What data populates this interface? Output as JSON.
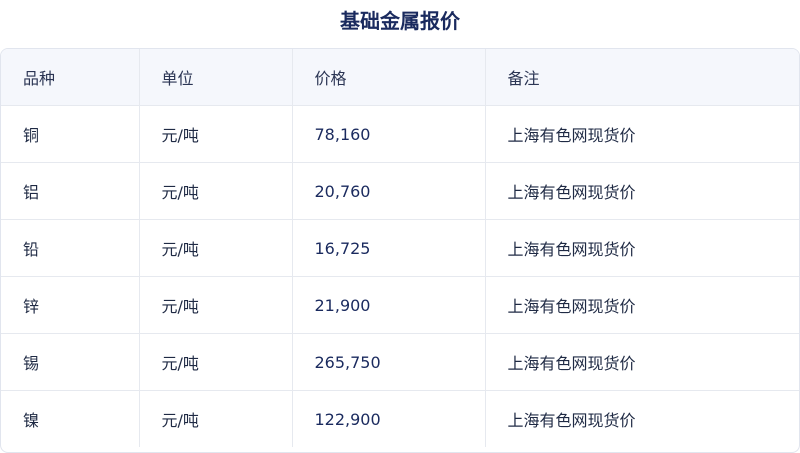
{
  "title": "基础金属报价",
  "table": {
    "headers": [
      "品种",
      "单位",
      "价格",
      "备注"
    ],
    "rows": [
      [
        "铜",
        "元/吨",
        "78,160",
        "上海有色网现货价"
      ],
      [
        "铝",
        "元/吨",
        "20,760",
        "上海有色网现货价"
      ],
      [
        "铅",
        "元/吨",
        "16,725",
        "上海有色网现货价"
      ],
      [
        "锌",
        "元/吨",
        "21,900",
        "上海有色网现货价"
      ],
      [
        "锡",
        "元/吨",
        "265,750",
        "上海有色网现货价"
      ],
      [
        "镍",
        "元/吨",
        "122,900",
        "上海有色网现货价"
      ]
    ]
  },
  "colors": {
    "title": "#1a2a5e",
    "header_bg": "#f5f7fc",
    "border": "#e6e9ef"
  }
}
